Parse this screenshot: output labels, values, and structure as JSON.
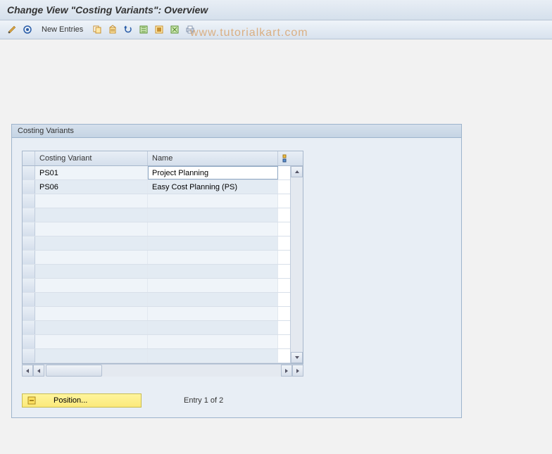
{
  "title": "Change View \"Costing Variants\": Overview",
  "toolbar": {
    "new_entries": "New Entries"
  },
  "watermark": "www.tutorialkart.com",
  "panel": {
    "header": "Costing Variants",
    "columns": {
      "variant": "Costing Variant",
      "name": "Name"
    },
    "rows": [
      {
        "variant": "PS01",
        "name": "Project Planning"
      },
      {
        "variant": "PS06",
        "name": "Easy Cost Planning (PS)"
      }
    ],
    "position_label": "Position...",
    "entry_status": "Entry 1 of 2"
  }
}
